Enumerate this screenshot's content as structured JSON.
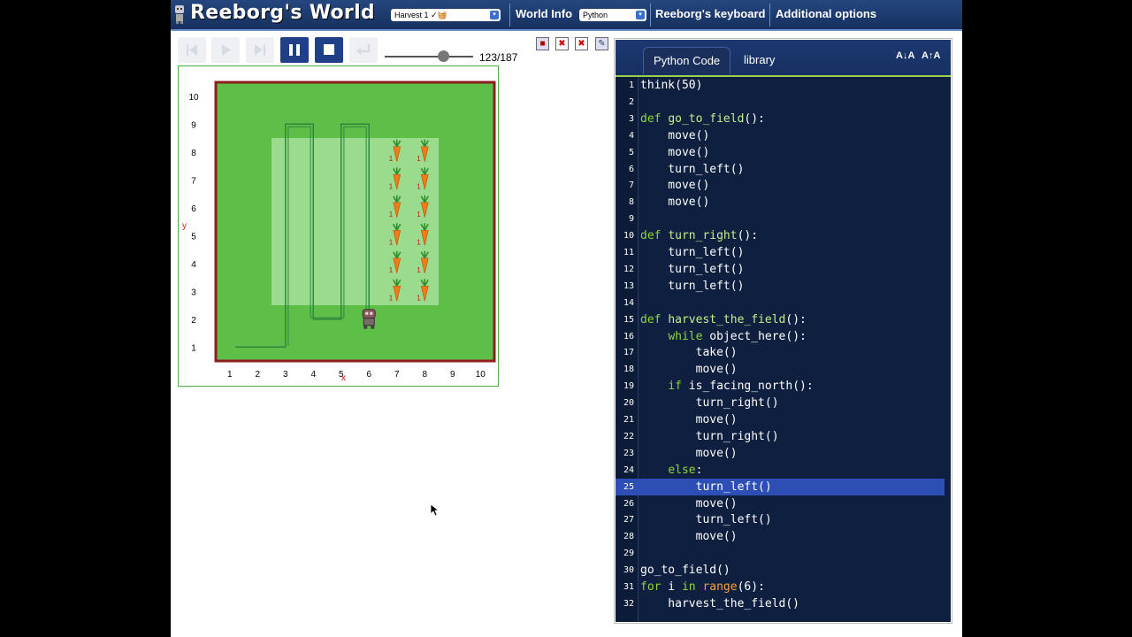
{
  "header": {
    "title": "Reeborg's World",
    "world_select": "Harvest 1 ✓🧺",
    "world_info": "World Info",
    "language_select": "Python",
    "keyboard": "Reeborg's keyboard",
    "additional_options": "Additional options"
  },
  "playback": {
    "step_label": "123/187",
    "progress_fraction": 0.657
  },
  "world": {
    "x_ticks": [
      "1",
      "2",
      "3",
      "4",
      "5",
      "6",
      "7",
      "8",
      "9",
      "10"
    ],
    "y_ticks": [
      "1",
      "2",
      "3",
      "4",
      "5",
      "6",
      "7",
      "8",
      "9",
      "10"
    ],
    "x_axis_label": "x",
    "y_axis_label": "y",
    "robot": {
      "x": 6,
      "y": 2
    },
    "carrots": [
      {
        "x": 7,
        "y": 3,
        "count": "1"
      },
      {
        "x": 8,
        "y": 3,
        "count": "1"
      },
      {
        "x": 7,
        "y": 4,
        "count": "1"
      },
      {
        "x": 8,
        "y": 4,
        "count": "1"
      },
      {
        "x": 7,
        "y": 5,
        "count": "1"
      },
      {
        "x": 8,
        "y": 5,
        "count": "1"
      },
      {
        "x": 7,
        "y": 6,
        "count": "1"
      },
      {
        "x": 8,
        "y": 6,
        "count": "1"
      },
      {
        "x": 7,
        "y": 7,
        "count": "1"
      },
      {
        "x": 8,
        "y": 7,
        "count": "1"
      },
      {
        "x": 7,
        "y": 8,
        "count": "1"
      },
      {
        "x": 8,
        "y": 8,
        "count": "1"
      }
    ],
    "colors": {
      "grass": "#5dbe48",
      "field": "#a6e09a",
      "wall": "#8f1f1f",
      "trace": "#2c8a3c"
    }
  },
  "editor": {
    "tabs": [
      "Python Code",
      "library"
    ],
    "font_down": "A↓A",
    "font_up": "A↑A",
    "highlight_line": 25,
    "lines": [
      "think(50)",
      "",
      "def go_to_field():",
      "    move()",
      "    move()",
      "    turn_left()",
      "    move()",
      "    move()",
      "",
      "def turn_right():",
      "    turn_left()",
      "    turn_left()",
      "    turn_left()",
      "",
      "def harvest_the_field():",
      "    while object_here():",
      "        take()",
      "        move()",
      "    if is_facing_north():",
      "        turn_right()",
      "        move()",
      "        turn_right()",
      "        move()",
      "    else:",
      "        turn_left()",
      "        move()",
      "        turn_left()",
      "        move()",
      "",
      "go_to_field()",
      "for i in range(6):",
      "    harvest_the_field()"
    ]
  }
}
